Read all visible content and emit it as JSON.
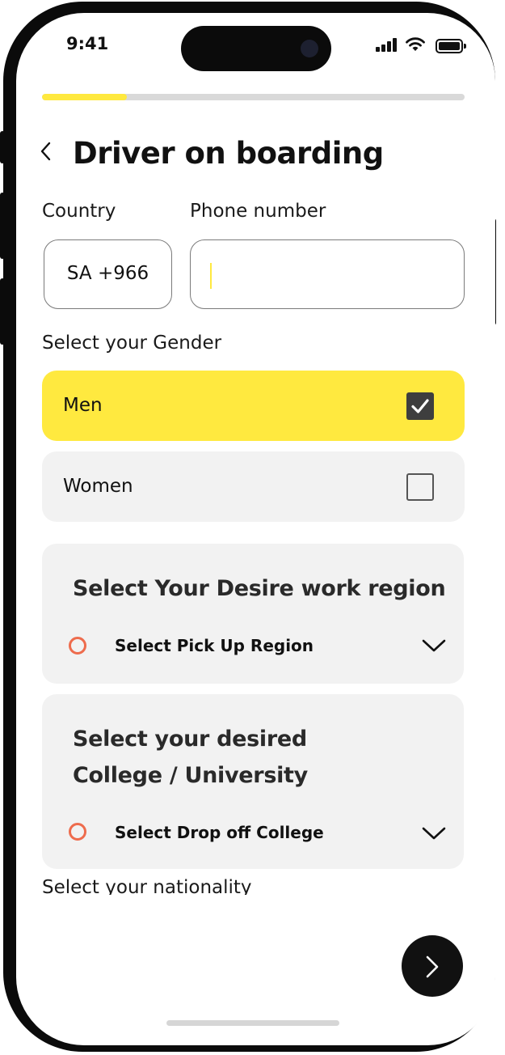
{
  "status_bar": {
    "time": "9:41"
  },
  "progress": {
    "fraction": 0.2,
    "color": "#ffe93f"
  },
  "header": {
    "title": "Driver on boarding",
    "back_icon": "chevron-left-icon"
  },
  "form": {
    "country_label": "Country",
    "country_value": "SA +966",
    "phone_label": "Phone number",
    "phone_value": "",
    "gender_label": "Select your Gender",
    "gender_options": [
      {
        "label": "Men",
        "checked": true,
        "bg": "#ffe93f"
      },
      {
        "label": "Women",
        "checked": false,
        "bg": "#f2f2f2"
      }
    ],
    "region_card": {
      "title": "Select Your Desire work region",
      "select_label": "Select Pick Up Region"
    },
    "college_card": {
      "title_line1": "Select your desired",
      "title_line2": "College / University",
      "select_label": "Select Drop off College"
    },
    "nationality_label": "Select your nationality"
  },
  "next_button": {
    "icon": "chevron-right-icon"
  },
  "colors": {
    "accent": "#ffe93f",
    "radio": "#ee6c4d",
    "card_bg": "#f2f2f2"
  }
}
